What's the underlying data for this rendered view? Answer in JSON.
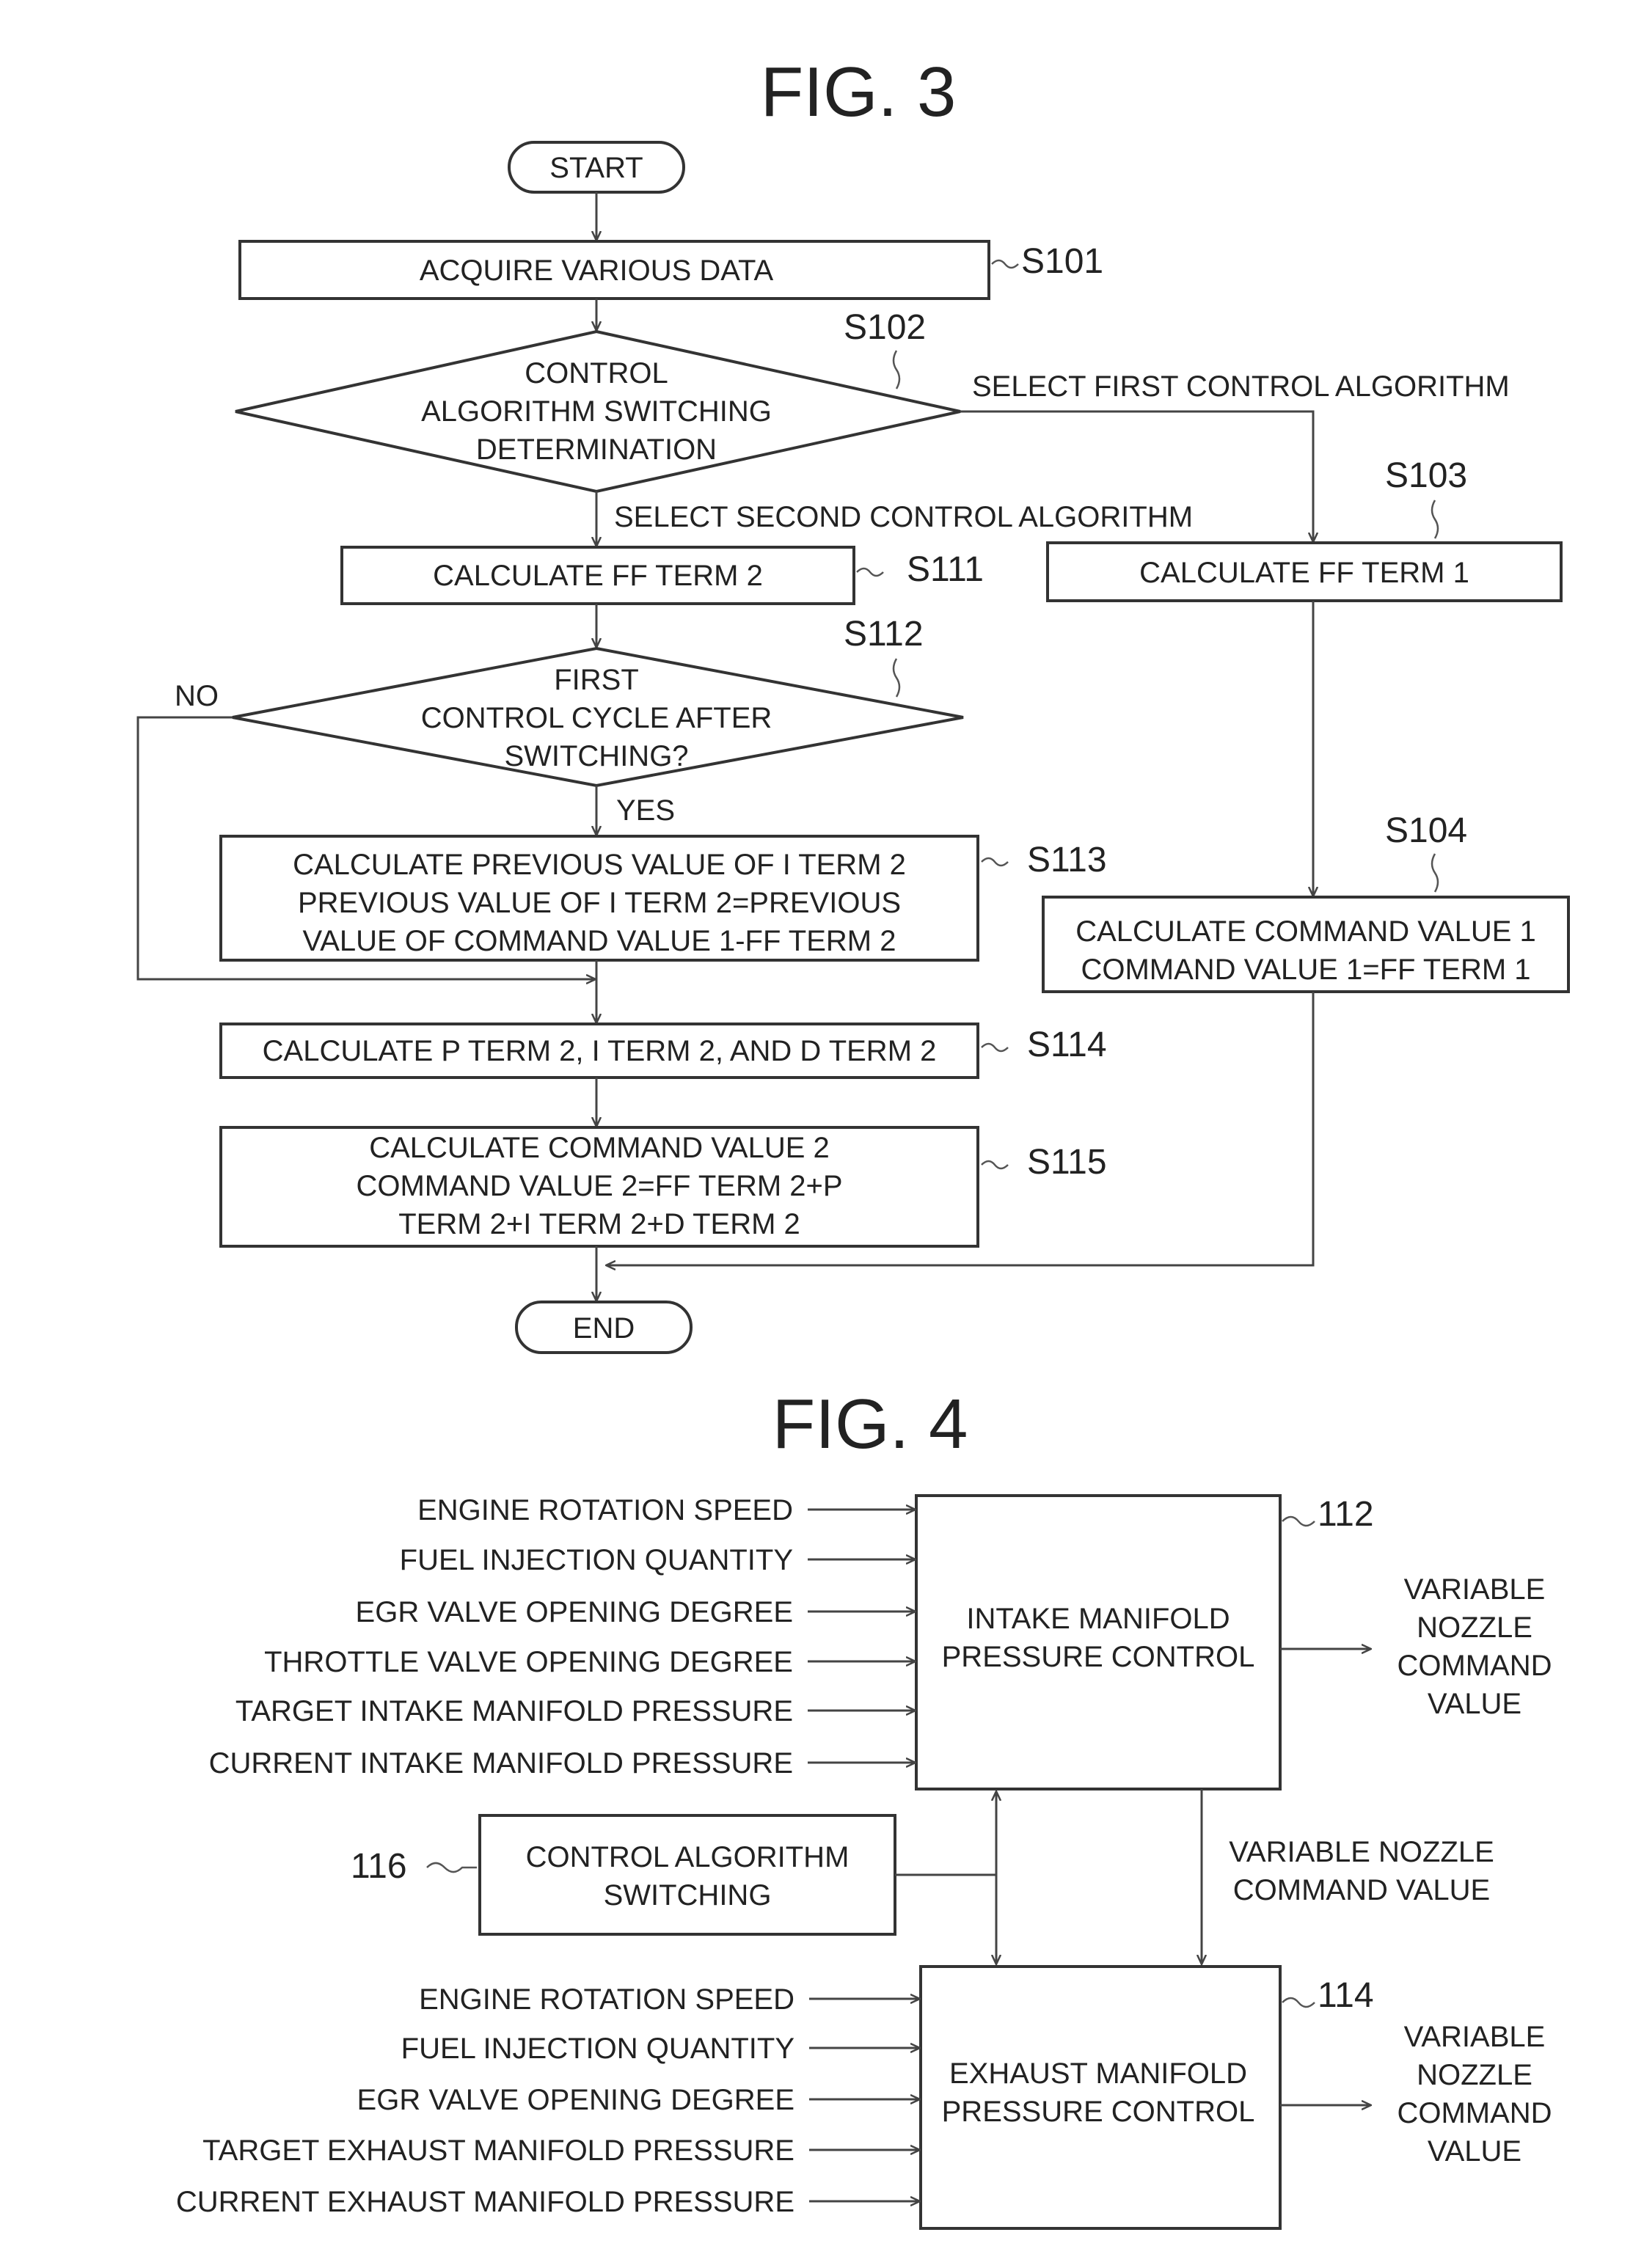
{
  "fig3": {
    "title": "FIG. 3",
    "start": "START",
    "end": "END",
    "s101": {
      "id": "S101",
      "text": "ACQUIRE VARIOUS DATA"
    },
    "s102": {
      "id": "S102",
      "lines": [
        "CONTROL",
        "ALGORITHM SWITCHING",
        "DETERMINATION"
      ]
    },
    "branch_first": "SELECT FIRST CONTROL ALGORITHM",
    "branch_second": "SELECT SECOND CONTROL ALGORITHM",
    "s103": {
      "id": "S103",
      "text": "CALCULATE FF TERM 1"
    },
    "s104": {
      "id": "S104",
      "lines": [
        "CALCULATE COMMAND VALUE 1",
        "COMMAND VALUE 1=FF TERM 1"
      ]
    },
    "s111": {
      "id": "S111",
      "text": "CALCULATE FF TERM 2"
    },
    "s112": {
      "id": "S112",
      "lines": [
        "FIRST",
        "CONTROL CYCLE AFTER",
        "SWITCHING?"
      ]
    },
    "no": "NO",
    "yes": "YES",
    "s113": {
      "id": "S113",
      "lines": [
        "CALCULATE PREVIOUS VALUE OF I TERM 2",
        "PREVIOUS VALUE OF I TERM 2=PREVIOUS",
        "VALUE OF COMMAND VALUE 1-FF TERM 2"
      ]
    },
    "s114": {
      "id": "S114",
      "text": "CALCULATE P TERM 2, I TERM 2, AND D TERM 2"
    },
    "s115": {
      "id": "S115",
      "lines": [
        "CALCULATE COMMAND VALUE 2",
        "COMMAND VALUE 2=FF TERM 2+P",
        "TERM 2+I TERM 2+D TERM 2"
      ]
    }
  },
  "fig4": {
    "title": "FIG. 4",
    "intake": {
      "ref": "112",
      "lines": [
        "INTAKE MANIFOLD",
        "PRESSURE CONTROL"
      ],
      "inputs": [
        "ENGINE ROTATION SPEED",
        "FUEL INJECTION QUANTITY",
        "EGR VALVE OPENING DEGREE",
        "THROTTLE VALVE OPENING DEGREE",
        "TARGET INTAKE MANIFOLD PRESSURE",
        "CURRENT INTAKE MANIFOLD PRESSURE"
      ],
      "output_lines": [
        "VARIABLE",
        "NOZZLE",
        "COMMAND",
        "VALUE"
      ]
    },
    "switching": {
      "ref": "116",
      "lines": [
        "CONTROL ALGORITHM",
        "SWITCHING"
      ]
    },
    "link_label": [
      "VARIABLE NOZZLE",
      "COMMAND VALUE"
    ],
    "exhaust": {
      "ref": "114",
      "lines": [
        "EXHAUST MANIFOLD",
        "PRESSURE CONTROL"
      ],
      "inputs": [
        "ENGINE ROTATION SPEED",
        "FUEL INJECTION QUANTITY",
        "EGR VALVE OPENING DEGREE",
        "TARGET EXHAUST MANIFOLD PRESSURE",
        "CURRENT EXHAUST MANIFOLD PRESSURE"
      ],
      "output_lines": [
        "VARIABLE",
        "NOZZLE",
        "COMMAND",
        "VALUE"
      ]
    }
  }
}
